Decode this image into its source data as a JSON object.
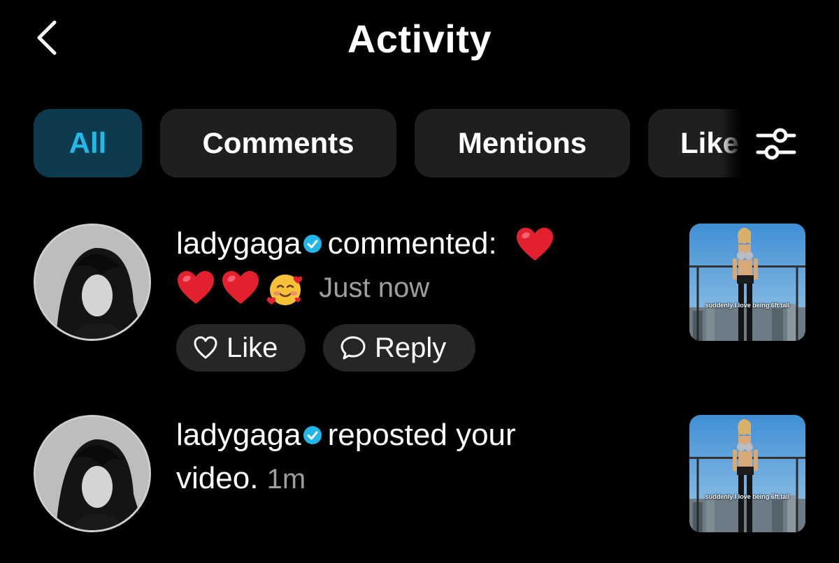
{
  "header": {
    "title": "Activity",
    "back_icon": "chevron-left-icon"
  },
  "tabs": [
    {
      "label": "All",
      "active": true
    },
    {
      "label": "Comments",
      "active": false
    },
    {
      "label": "Mentions",
      "active": false
    },
    {
      "label": "Likes",
      "active": false
    }
  ],
  "filter_icon": "sliders-icon",
  "notifications": [
    {
      "username": "ladygaga",
      "verified": true,
      "action": "commented:",
      "comment_emojis": [
        "red-heart",
        "red-heart",
        "red-heart",
        "smiling-face-with-hearts"
      ],
      "time": "Just now",
      "like_label": "Like",
      "reply_label": "Reply",
      "thumbnail_caption": "suddenly I love being 6ft tall"
    },
    {
      "username": "ladygaga",
      "verified": true,
      "action_line1": "reposted your",
      "action_line2": "video.",
      "time": "1m",
      "thumbnail_caption": "suddenly I love being 6ft tall"
    }
  ],
  "colors": {
    "background": "#000000",
    "tab_bg": "#1f1f1f",
    "tab_active_bg": "#0d3a4d",
    "tab_active_text": "#22b8e8",
    "verified": "#20b6e8",
    "timestamp": "#9e9e9e",
    "pill_bg": "#262626"
  }
}
